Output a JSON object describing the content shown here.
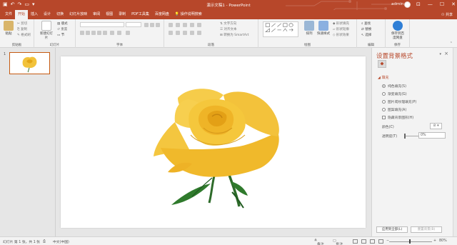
{
  "titlebar": {
    "title": "演示文稿1 - PowerPoint",
    "user": "admin",
    "qat_icons": [
      "save-icon",
      "undo-icon",
      "redo-icon",
      "present-icon",
      "customize-icon"
    ]
  },
  "tabs": [
    "文件",
    "开始",
    "插入",
    "设计",
    "切换",
    "幻灯片放映",
    "审阅",
    "视图",
    "录制",
    "PDF工具集",
    "百度网盘"
  ],
  "active_tab": "开始",
  "tell_me": "操作说明搜索",
  "share": "共享",
  "ribbon": {
    "clipboard": {
      "paste": "粘贴",
      "cut": "剪切",
      "copy": "复制",
      "format": "格式刷",
      "label": "剪贴板"
    },
    "slides": {
      "new_slide": "新建幻灯片",
      "layout": "版式",
      "reset": "重置",
      "section": "节",
      "label": "幻灯片"
    },
    "font": {
      "label": "字体"
    },
    "paragraph": {
      "label": "段落",
      "text_direction": "文字方向",
      "align_text": "对齐文本",
      "smartart": "转换为 SmartArt"
    },
    "drawing": {
      "arrange": "排列",
      "quick_styles": "快速样式",
      "shape_fill": "形状填充",
      "shape_outline": "形状轮廓",
      "shape_effect": "形状效果",
      "label": "绘图"
    },
    "editing": {
      "find": "查找",
      "replace": "替换",
      "select": "选择",
      "label": "编辑"
    },
    "save": {
      "label": "保存到百度网盘",
      "group": "保存"
    }
  },
  "thumbnails": [
    {
      "number": "1"
    }
  ],
  "format_pane": {
    "title": "设置背景格式",
    "section": "填充",
    "options": [
      "纯色填充(S)",
      "渐变填充(G)",
      "图片或纹理填充(P)",
      "图案填充(A)",
      "隐藏背景图形(H)"
    ],
    "selected_option": "纯色填充(S)",
    "color_label": "颜色(C)",
    "transparency_label": "透明度(T)",
    "transparency_value": "0%",
    "apply_all": "应用到全部(L)",
    "reset_background": "重置背景(B)"
  },
  "status": {
    "slide_info": "幻灯片 第 1 张，共 1 张",
    "language": "中文(中国)",
    "notes": "备注",
    "comments": "批注",
    "zoom": "80%"
  },
  "colors": {
    "accent": "#b7472a",
    "rose_petal": "#f2c23a",
    "stem": "#2e6b2a"
  }
}
